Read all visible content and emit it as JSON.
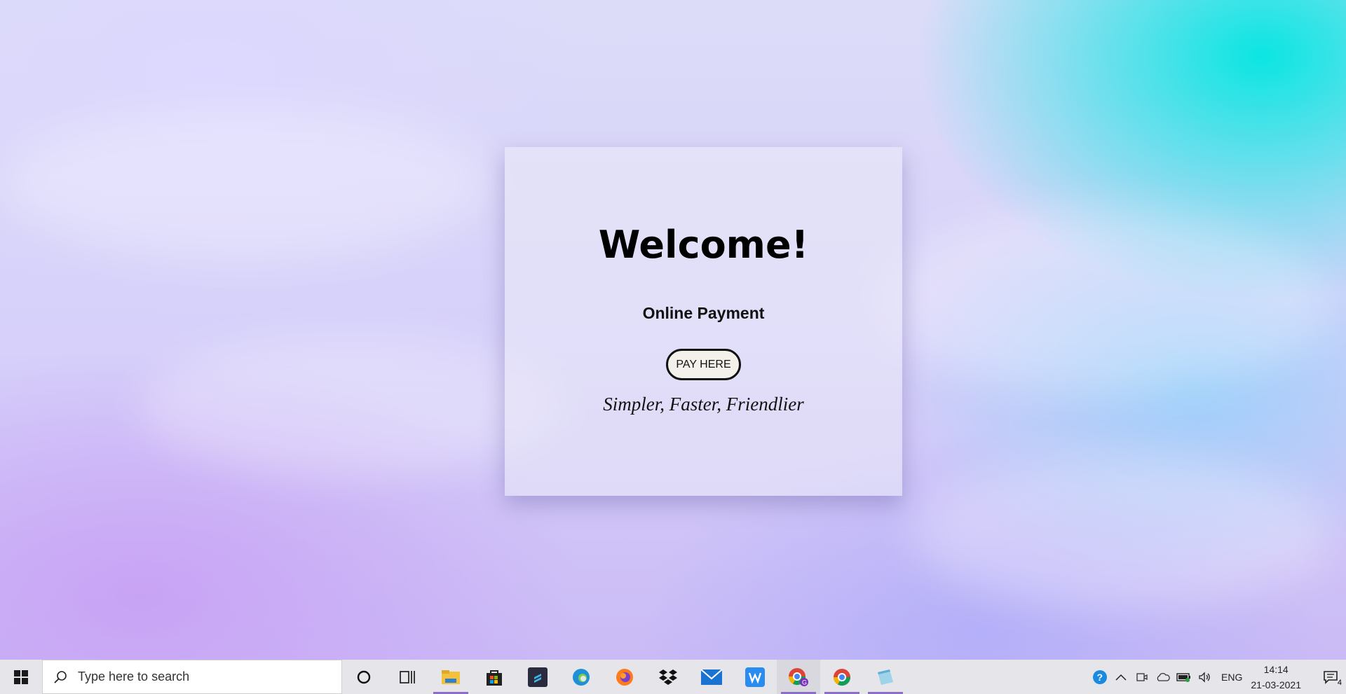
{
  "card": {
    "title": "Welcome!",
    "subtitle": "Online Payment",
    "button_label": "PAY HERE",
    "tagline": "Simpler, Faster, Friendlier"
  },
  "taskbar": {
    "search_placeholder": "Type here to search",
    "apps": [
      "cortana",
      "task-view",
      "file-explorer",
      "microsoft-store",
      "sublime-text",
      "edge",
      "firefox",
      "dropbox",
      "mail",
      "wps-office",
      "chrome-profile",
      "chrome",
      "notepad"
    ],
    "tray": {
      "language": "ENG",
      "time": "14:14",
      "date": "21-03-2021",
      "notification_count": "4"
    }
  },
  "colors": {
    "accent": "#8b6fc7",
    "button_bg": "#f4f1ea"
  }
}
